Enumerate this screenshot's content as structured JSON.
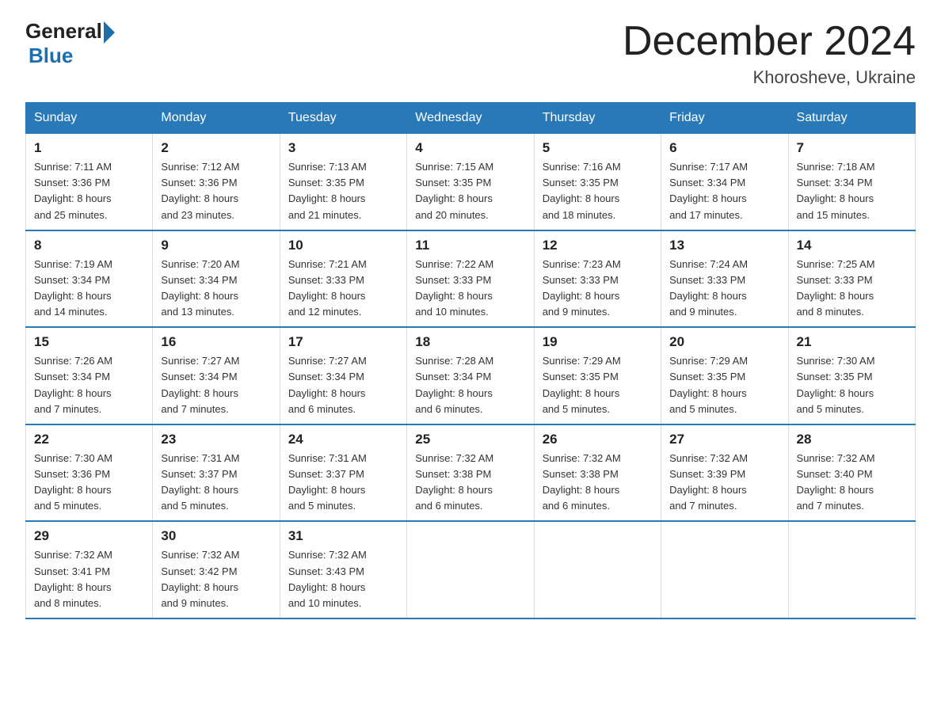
{
  "logo": {
    "general": "General",
    "blue": "Blue"
  },
  "title": "December 2024",
  "subtitle": "Khorosheve, Ukraine",
  "weekdays": [
    "Sunday",
    "Monday",
    "Tuesday",
    "Wednesday",
    "Thursday",
    "Friday",
    "Saturday"
  ],
  "weeks": [
    [
      {
        "day": "1",
        "sunrise": "7:11 AM",
        "sunset": "3:36 PM",
        "daylight": "8 hours and 25 minutes."
      },
      {
        "day": "2",
        "sunrise": "7:12 AM",
        "sunset": "3:36 PM",
        "daylight": "8 hours and 23 minutes."
      },
      {
        "day": "3",
        "sunrise": "7:13 AM",
        "sunset": "3:35 PM",
        "daylight": "8 hours and 21 minutes."
      },
      {
        "day": "4",
        "sunrise": "7:15 AM",
        "sunset": "3:35 PM",
        "daylight": "8 hours and 20 minutes."
      },
      {
        "day": "5",
        "sunrise": "7:16 AM",
        "sunset": "3:35 PM",
        "daylight": "8 hours and 18 minutes."
      },
      {
        "day": "6",
        "sunrise": "7:17 AM",
        "sunset": "3:34 PM",
        "daylight": "8 hours and 17 minutes."
      },
      {
        "day": "7",
        "sunrise": "7:18 AM",
        "sunset": "3:34 PM",
        "daylight": "8 hours and 15 minutes."
      }
    ],
    [
      {
        "day": "8",
        "sunrise": "7:19 AM",
        "sunset": "3:34 PM",
        "daylight": "8 hours and 14 minutes."
      },
      {
        "day": "9",
        "sunrise": "7:20 AM",
        "sunset": "3:34 PM",
        "daylight": "8 hours and 13 minutes."
      },
      {
        "day": "10",
        "sunrise": "7:21 AM",
        "sunset": "3:33 PM",
        "daylight": "8 hours and 12 minutes."
      },
      {
        "day": "11",
        "sunrise": "7:22 AM",
        "sunset": "3:33 PM",
        "daylight": "8 hours and 10 minutes."
      },
      {
        "day": "12",
        "sunrise": "7:23 AM",
        "sunset": "3:33 PM",
        "daylight": "8 hours and 9 minutes."
      },
      {
        "day": "13",
        "sunrise": "7:24 AM",
        "sunset": "3:33 PM",
        "daylight": "8 hours and 9 minutes."
      },
      {
        "day": "14",
        "sunrise": "7:25 AM",
        "sunset": "3:33 PM",
        "daylight": "8 hours and 8 minutes."
      }
    ],
    [
      {
        "day": "15",
        "sunrise": "7:26 AM",
        "sunset": "3:34 PM",
        "daylight": "8 hours and 7 minutes."
      },
      {
        "day": "16",
        "sunrise": "7:27 AM",
        "sunset": "3:34 PM",
        "daylight": "8 hours and 7 minutes."
      },
      {
        "day": "17",
        "sunrise": "7:27 AM",
        "sunset": "3:34 PM",
        "daylight": "8 hours and 6 minutes."
      },
      {
        "day": "18",
        "sunrise": "7:28 AM",
        "sunset": "3:34 PM",
        "daylight": "8 hours and 6 minutes."
      },
      {
        "day": "19",
        "sunrise": "7:29 AM",
        "sunset": "3:35 PM",
        "daylight": "8 hours and 5 minutes."
      },
      {
        "day": "20",
        "sunrise": "7:29 AM",
        "sunset": "3:35 PM",
        "daylight": "8 hours and 5 minutes."
      },
      {
        "day": "21",
        "sunrise": "7:30 AM",
        "sunset": "3:35 PM",
        "daylight": "8 hours and 5 minutes."
      }
    ],
    [
      {
        "day": "22",
        "sunrise": "7:30 AM",
        "sunset": "3:36 PM",
        "daylight": "8 hours and 5 minutes."
      },
      {
        "day": "23",
        "sunrise": "7:31 AM",
        "sunset": "3:37 PM",
        "daylight": "8 hours and 5 minutes."
      },
      {
        "day": "24",
        "sunrise": "7:31 AM",
        "sunset": "3:37 PM",
        "daylight": "8 hours and 5 minutes."
      },
      {
        "day": "25",
        "sunrise": "7:32 AM",
        "sunset": "3:38 PM",
        "daylight": "8 hours and 6 minutes."
      },
      {
        "day": "26",
        "sunrise": "7:32 AM",
        "sunset": "3:38 PM",
        "daylight": "8 hours and 6 minutes."
      },
      {
        "day": "27",
        "sunrise": "7:32 AM",
        "sunset": "3:39 PM",
        "daylight": "8 hours and 7 minutes."
      },
      {
        "day": "28",
        "sunrise": "7:32 AM",
        "sunset": "3:40 PM",
        "daylight": "8 hours and 7 minutes."
      }
    ],
    [
      {
        "day": "29",
        "sunrise": "7:32 AM",
        "sunset": "3:41 PM",
        "daylight": "8 hours and 8 minutes."
      },
      {
        "day": "30",
        "sunrise": "7:32 AM",
        "sunset": "3:42 PM",
        "daylight": "8 hours and 9 minutes."
      },
      {
        "day": "31",
        "sunrise": "7:32 AM",
        "sunset": "3:43 PM",
        "daylight": "8 hours and 10 minutes."
      },
      null,
      null,
      null,
      null
    ]
  ]
}
